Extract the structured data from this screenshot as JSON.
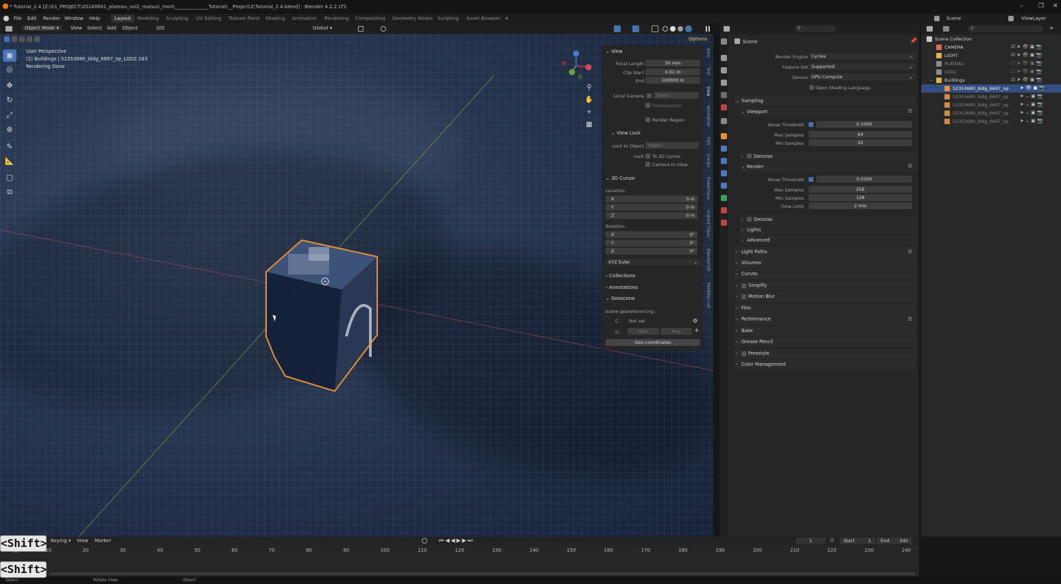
{
  "window": {
    "title": "* Tutorial_2.4 [Z:\\01_PROJECT\\20240601_plateau_vol2_matsui\\_mori\\______________Tutorial\\__Project\\2\\Tutorial_2.4.blend] - Blender 4.2.2 LTS",
    "minimize": "–",
    "maximize": "❐",
    "close": "✕"
  },
  "menus": [
    "File",
    "Edit",
    "Render",
    "Window",
    "Help"
  ],
  "workspaces": [
    "Layout",
    "Modeling",
    "Sculpting",
    "UV Editing",
    "Texture Paint",
    "Shading",
    "Animation",
    "Rendering",
    "Compositing",
    "Geometry Nodes",
    "Scripting",
    "Asset Browser"
  ],
  "workspace_add": "+",
  "scene_selector": {
    "scene": "Scene",
    "view_layer": "ViewLayer"
  },
  "viewport_header": {
    "mode": "Object Mode",
    "menus": [
      "View",
      "Select",
      "Add",
      "Object"
    ],
    "gis": "GIS",
    "transform": "Global",
    "options": "Options"
  },
  "viewport": {
    "line1": "User Perspective",
    "line2": "(1) Buildings | 52353680_bldg_6697_op_LOD2.163",
    "line3": "Rendering Done"
  },
  "npanel": {
    "view": {
      "title": "View",
      "focal_length_label": "Focal Length",
      "focal_length": "50 mm",
      "clip_start_label": "Clip Start",
      "clip_start": "0.01 m",
      "end_label": "End",
      "end": "100000 m",
      "local_camera_label": "Local Camera",
      "local_camera": "Object",
      "passepartout": "Passepartout",
      "render_region": "Render Region"
    },
    "view_lock": {
      "title": "View Lock",
      "lock_to_object_label": "Lock to Object",
      "lock_to_object": "Object",
      "lock_label": "Lock",
      "to_3d_cursor": "To 3D Cursor",
      "camera_to_view": "Camera to View"
    },
    "cursor": {
      "title": "3D Cursor",
      "location_label": "Location:",
      "x_label": "X",
      "x": "0 m",
      "y_label": "Y",
      "y": "0 m",
      "z_label": "Z",
      "z": "0 m",
      "rotation_label": "Rotation:",
      "rx": "0°",
      "ry": "0°",
      "rz": "0°",
      "rotation_mode": "XYZ Euler"
    },
    "collections": "Collections",
    "annotations": "Annotations",
    "geoscene": {
      "title": "Geoscene",
      "georef_label": "Scene georeferencing :",
      "crs_short": "C...",
      "crs_value": "Not set",
      "origin_short": "O...",
      "geo": "Geo",
      "proj": "Proj",
      "geo_coordinates": "Geo-coordinates"
    },
    "tabs": [
      "Item",
      "Tool",
      "View",
      "Animation",
      "Edit",
      "Create",
      "PowerSave",
      "Instant Clean",
      "BlenderGIS",
      "Modifier List"
    ]
  },
  "properties": {
    "header": "Scene",
    "render_engine_label": "Render Engine",
    "render_engine": "Cycles",
    "feature_set_label": "Feature Set",
    "feature_set": "Supported",
    "device_label": "Device",
    "device": "GPU Compute",
    "osl": "Open Shading Language",
    "sampling": "Sampling",
    "viewport": "Viewport",
    "vp_noise_label": "Noise Threshold",
    "vp_noise": "0.1000",
    "vp_max_label": "Max Samples",
    "vp_max": "64",
    "vp_min_label": "Min Samples",
    "vp_min": "32",
    "denoise": "Denoise",
    "render": "Render",
    "r_noise_label": "Noise Threshold",
    "r_noise": "0.0100",
    "r_max_label": "Max Samples",
    "r_max": "256",
    "r_min_label": "Min Samples",
    "r_min": "128",
    "time_limit_label": "Time Limit",
    "time_limit": "2 min",
    "denoise2": "Denoise",
    "lights": "Lights",
    "advanced": "Advanced",
    "sections": [
      "Light Paths",
      "Volumes",
      "Curves",
      "Simplify",
      "Motion Blur",
      "Film",
      "Performance",
      "Bake",
      "Grease Pencil",
      "Freestyle",
      "Color Management"
    ]
  },
  "outliner": {
    "root": "Scene Collection",
    "items": [
      {
        "name": "CAMERA",
        "color": "#e06a5a"
      },
      {
        "name": "LIGHT",
        "color": "#e0b34a"
      },
      {
        "name": "PLATEAU",
        "color": "#8a8a8a"
      },
      {
        "name": "LOD2",
        "color": "#8a8a8a"
      },
      {
        "name": "Buildings",
        "color": "#e0b34a"
      }
    ],
    "children": [
      "52353680_bldg_6697_op",
      "52353680_bldg_6697_op",
      "52353680_bldg_6697_op",
      "52353680_bldg_6697_op",
      "52353680_bldg_6697_op"
    ]
  },
  "timeline": {
    "menus": [
      "Keying",
      "View",
      "Marker"
    ],
    "current_frame": "1",
    "start_label": "Start",
    "start": "1",
    "end_label": "End",
    "end": "240",
    "ticks": [
      "10",
      "20",
      "30",
      "40",
      "50",
      "60",
      "70",
      "80",
      "90",
      "100",
      "110",
      "120",
      "130",
      "140",
      "150",
      "160",
      "170",
      "180",
      "190",
      "200",
      "210",
      "220",
      "230",
      "240"
    ]
  },
  "statusbar": {
    "select": "Select",
    "rotate": "Rotate View",
    "object": "Object"
  },
  "overlay_keys": [
    "<Shift>",
    "<Shift>"
  ],
  "colors": {
    "accent": "#4772b3",
    "selection_outline": "#e8912e",
    "header": "#1f1f1f",
    "panel": "#262626"
  }
}
